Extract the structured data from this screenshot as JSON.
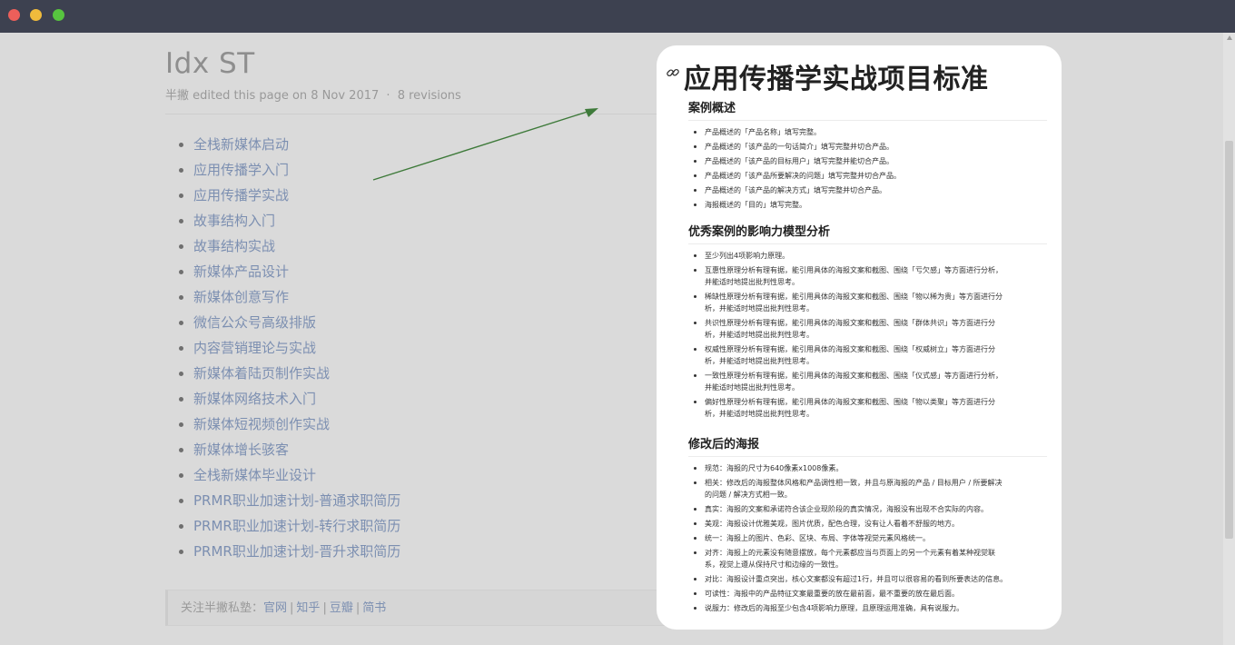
{
  "window": {
    "buttons": [
      "close",
      "minimize",
      "zoom"
    ]
  },
  "wiki": {
    "title": "Idx ST",
    "meta_author": "半撇",
    "meta_text": "edited this page on 8 Nov 2017",
    "meta_sep": "·",
    "meta_revisions": "8 revisions",
    "links": [
      "全栈新媒体启动",
      "应用传播学入门",
      "应用传播学实战",
      "故事结构入门",
      "故事结构实战",
      "新媒体产品设计",
      "新媒体创意写作",
      "微信公众号高级排版",
      "内容营销理论与实战",
      "新媒体着陆页制作实战",
      "新媒体网络技术入门",
      "新媒体短视频创作实战",
      "新媒体增长骇客",
      "全栈新媒体毕业设计",
      "PRMR职业加速计划-普通求职简历",
      "PRMR职业加速计划-转行求职简历",
      "PRMR职业加速计划-晋升求职简历"
    ],
    "footer": {
      "prefix": "关注半撇私塾：",
      "links": [
        "官网",
        "知乎",
        "豆瓣",
        "简书"
      ],
      "pipe": "|"
    }
  },
  "card": {
    "title": "应用传播学实战项目标准",
    "sections": [
      {
        "heading": "案例概述",
        "items": [
          "产品概述的「产品名称」填写完整。",
          "产品概述的「该产品的一句话简介」填写完整并切合产品。",
          "产品概述的「该产品的目标用户」填写完整并能切合产品。",
          "产品概述的「该产品所要解决的问题」填写完整并切合产品。",
          "产品概述的「该产品的解决方式」填写完整并切合产品。",
          "海报概述的「目的」填写完整。"
        ]
      },
      {
        "heading": "优秀案例的影响力模型分析",
        "items": [
          "至少列出4项影响力原理。",
          "互惠性原理分析有理有据，能引用具体的海报文案和截图、围绕「亏欠感」等方面进行分析，\n并能适时地提出批判性思考。",
          "稀缺性原理分析有理有据，能引用具体的海报文案和截图、围绕「物以稀为贵」等方面进行分\n析，并能适时地提出批判性思考。",
          "共识性原理分析有理有据，能引用具体的海报文案和截图、围绕「群体共识」等方面进行分\n析，并能适时地提出批判性思考。",
          "权威性原理分析有理有据，能引用具体的海报文案和截图、围绕「权威树立」等方面进行分\n析，并能适时地提出批判性思考。",
          "一致性原理分析有理有据，能引用具体的海报文案和截图、围绕「仪式感」等方面进行分析，\n并能适时地提出批判性思考。",
          "偏好性原理分析有理有据，能引用具体的海报文案和截图、围绕「物以类聚」等方面进行分\n析，并能适时地提出批判性思考。"
        ]
      },
      {
        "heading": "修改后的海报",
        "items": [
          "规范：海报的尺寸为640像素x1008像素。",
          "相关：修改后的海报整体风格和产品调性相一致，并且与原海报的产品 / 目标用户 / 所要解决\n的问题 / 解决方式相一致。",
          "真实：海报的文案和承诺符合该企业现阶段的真实情况，海报没有出现不合实际的内容。",
          "美观：海报设计优雅美观，图片优质，配色合理，没有让人看着不舒服的地方。",
          "统一：海报上的图片、色彩、区块、布局、字体等视觉元素风格统一。",
          "对齐：海报上的元素没有随意摆放，每个元素都应当与页面上的另一个元素有着某种视觉联\n系，视觉上遵从保持尺寸和边缘的一致性。",
          "对比：海报设计重点突出，核心文案都没有超过1行，并且可以很容易的看到所要表达的信息。",
          "可读性：海报中的产品特征文案最重要的放在最前面，最不重要的放在最后面。",
          "说服力：修改后的海报至少包含4项影响力原理，且原理运用准确，具有说服力。"
        ]
      }
    ]
  },
  "colors": {
    "titlebar": "#3d4150",
    "page_bg": "#dadada",
    "link": "#7c8fb1",
    "arrow": "#3e7a3a"
  },
  "icons": [
    "link-icon",
    "arrow-annotation"
  ]
}
